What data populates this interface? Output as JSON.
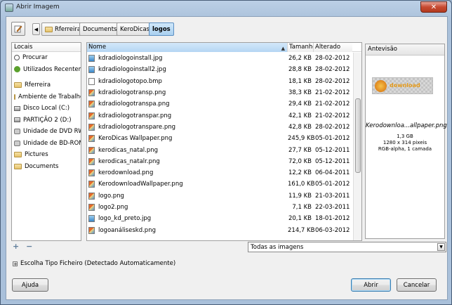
{
  "window": {
    "title": "Abrir Imagem",
    "close_label": "✕"
  },
  "breadcrumb": [
    "Rferreira",
    "Documents",
    "KeroDicas",
    "logos"
  ],
  "places": {
    "header": "Locais",
    "items": [
      {
        "label": "Procurar",
        "icon": "search-icon"
      },
      {
        "label": "Utilizados Recentem...",
        "icon": "recent-icon"
      },
      {
        "label": "Rferreira",
        "icon": "folder-icon"
      },
      {
        "label": "Ambiente de Trabalho",
        "icon": "folder-icon"
      },
      {
        "label": "Disco Local (C:)",
        "icon": "drive-icon"
      },
      {
        "label": "PARTIÇÃO 2 (D:)",
        "icon": "drive-icon"
      },
      {
        "label": "Unidade de DVD RW ...",
        "icon": "disc-icon"
      },
      {
        "label": "Unidade de BD-ROM...",
        "icon": "disc-icon"
      },
      {
        "label": "Pictures",
        "icon": "folder-icon"
      },
      {
        "label": "Documents",
        "icon": "folder-icon"
      }
    ],
    "add_label": "+",
    "remove_label": "−"
  },
  "files": {
    "columns": {
      "name": "Nome",
      "size": "Tamanho",
      "date": "Alterado"
    },
    "rows": [
      {
        "name": "kdradiologoinstall.jpg",
        "size": "26,2 KB",
        "date": "28-02-2012",
        "type": "jpg"
      },
      {
        "name": "kdradiologoinstall2.jpg",
        "size": "28,8 KB",
        "date": "28-02-2012",
        "type": "jpg"
      },
      {
        "name": "kdradiologotopo.bmp",
        "size": "18,1 KB",
        "date": "28-02-2012",
        "type": "bmp"
      },
      {
        "name": "kdradiologotransp.png",
        "size": "38,3 KB",
        "date": "21-02-2012",
        "type": "png"
      },
      {
        "name": "kdradiologotranspa.png",
        "size": "29,4 KB",
        "date": "21-02-2012",
        "type": "png"
      },
      {
        "name": "kdradiologotranspar.png",
        "size": "42,1 KB",
        "date": "21-02-2012",
        "type": "png"
      },
      {
        "name": "kdradiologotranspare.png",
        "size": "42,8 KB",
        "date": "28-02-2012",
        "type": "png"
      },
      {
        "name": "KeroDicas Wallpaper.png",
        "size": "245,9 KB",
        "date": "05-01-2012",
        "type": "png"
      },
      {
        "name": "kerodicas_natal.png",
        "size": "27,7 KB",
        "date": "05-12-2011",
        "type": "png"
      },
      {
        "name": "kerodicas_natalr.png",
        "size": "72,0 KB",
        "date": "05-12-2011",
        "type": "png"
      },
      {
        "name": "kerodownload.png",
        "size": "12,2 KB",
        "date": "06-04-2011",
        "type": "png"
      },
      {
        "name": "KerodownloadWallpaper.png",
        "size": "161,0 KB",
        "date": "05-01-2012",
        "type": "png"
      },
      {
        "name": "logo.png",
        "size": "11,9 KB",
        "date": "21-03-2011",
        "type": "png"
      },
      {
        "name": "logo2.png",
        "size": "7,1 KB",
        "date": "22-03-2011",
        "type": "png"
      },
      {
        "name": "logo_kd_preto.jpg",
        "size": "20,1 KB",
        "date": "18-01-2012",
        "type": "jpg"
      },
      {
        "name": "logoanáliseskd.png",
        "size": "214,7 KB",
        "date": "06-03-2012",
        "type": "png"
      }
    ]
  },
  "preview": {
    "header": "Antevisão",
    "image_text": "download",
    "name": "Kerodownloa...allpaper.png",
    "size": "1,3 GB",
    "dimensions": "1280 x 314 pixeis",
    "format": "RGB-alpha, 1 camada"
  },
  "filter": {
    "selected": "Todas as imagens"
  },
  "file_type_expander": "Escolha Tipo Ficheiro (Detectado Automaticamente)",
  "buttons": {
    "help": "Ajuda",
    "open": "Abrir",
    "cancel": "Cancelar"
  }
}
